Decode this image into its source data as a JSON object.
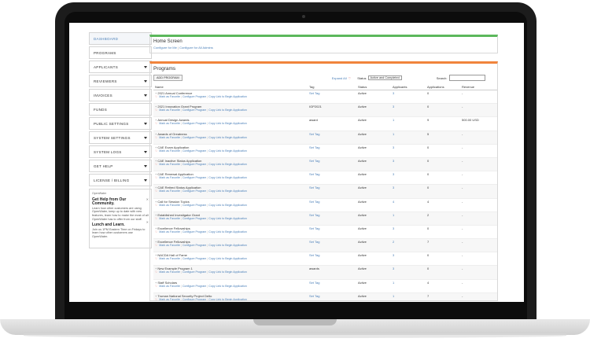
{
  "sidebar": {
    "items": [
      {
        "label": "DASHBOARD",
        "caret": false,
        "active": true
      },
      {
        "label": "PROGRAMS",
        "caret": false
      },
      {
        "label": "APPLICANTS",
        "caret": true
      },
      {
        "label": "REVIEWERS",
        "caret": true
      },
      {
        "label": "INVOICES",
        "caret": true
      },
      {
        "label": "FUNDS",
        "caret": false
      },
      {
        "label": "PUBLIC SETTINGS",
        "caret": true
      },
      {
        "label": "SYSTEM SETTINGS",
        "caret": true
      },
      {
        "label": "SYSTEM LOGS",
        "caret": true
      },
      {
        "label": "GET HELP",
        "caret": true
      },
      {
        "label": "LICENSE / BILLING",
        "caret": true
      }
    ],
    "help": {
      "header": "OpenWater",
      "title1": "Get Help from Our Community.",
      "body1": "Learn how other customers are using OpenWater, keep up to date with new features, learn how to make the most of all OpenWater has to offer from our staff.",
      "title2": "Lunch and Learn.",
      "body2": "Join us 1PM Eastern Time on Fridays to learn how other customers use OpenWater."
    }
  },
  "home": {
    "title": "Home Screen",
    "link_me": "Configure for Me",
    "separator": "|",
    "link_all": "Configure for All Admins"
  },
  "programs": {
    "title": "Programs",
    "add_button": "ADD PROGRAM",
    "expand_all": "Expand All",
    "status_label": "Status",
    "status_value": "Active and Completed",
    "search_label": "Search:",
    "columns": [
      "Name",
      "Tag",
      "Status",
      "Applicants",
      "Applications",
      "Revenue"
    ],
    "link_fav": "Mark as Favorite",
    "link_cfg": "Configure Program",
    "link_copy": "Copy Link to Begin Application",
    "rows": [
      {
        "name": "2021 Annual Conference",
        "tag": "Set Tag",
        "status": "Active",
        "applicants": "3",
        "applications": "0",
        "revenue": "-"
      },
      {
        "name": "2021 Innovation Grant Program",
        "tag": "IGP2021",
        "status": "Active",
        "applicants": "3",
        "applications": "0",
        "revenue": "-"
      },
      {
        "name": "Annual Design Awards",
        "tag": "award",
        "status": "Active",
        "applicants": "1",
        "applications": "9",
        "revenue": "500.00 USD"
      },
      {
        "name": "Awards of Greatness",
        "tag": "Set Tag",
        "status": "Active",
        "applicants": "1",
        "applications": "5",
        "revenue": "-"
      },
      {
        "name": "CAE Exam Application",
        "tag": "Set Tag",
        "status": "Active",
        "applicants": "3",
        "applications": "0",
        "revenue": "-"
      },
      {
        "name": "CAE Inactive Status Application",
        "tag": "Set Tag",
        "status": "Active",
        "applicants": "3",
        "applications": "0",
        "revenue": "-"
      },
      {
        "name": "CAE Renewal Application",
        "tag": "Set Tag",
        "status": "Active",
        "applicants": "3",
        "applications": "0",
        "revenue": "-"
      },
      {
        "name": "CAE Retired Status Application",
        "tag": "Set Tag",
        "status": "Active",
        "applicants": "3",
        "applications": "0",
        "revenue": "-"
      },
      {
        "name": "Call for Session Topics",
        "tag": "Set Tag",
        "status": "Active",
        "applicants": "4",
        "applications": "4",
        "revenue": "-"
      },
      {
        "name": "Established Investigator Grant",
        "tag": "Set Tag",
        "status": "Active",
        "applicants": "1",
        "applications": "2",
        "revenue": "-"
      },
      {
        "name": "Excellence Fellowships",
        "tag": "Set Tag",
        "status": "Active",
        "applicants": "3",
        "applications": "0",
        "revenue": "-"
      },
      {
        "name": "Excellence Fellowships",
        "tag": "Set Tag",
        "status": "Active",
        "applicants": "2",
        "applications": "7",
        "revenue": "-"
      },
      {
        "name": "NACDA Hall of Fame",
        "tag": "Set Tag",
        "status": "Active",
        "applicants": "3",
        "applications": "0",
        "revenue": "-"
      },
      {
        "name": "New Example Program 1",
        "tag": "awards",
        "status": "Active",
        "applicants": "3",
        "applications": "0",
        "revenue": "-"
      },
      {
        "name": "Staff Scholars",
        "tag": "Set Tag",
        "status": "Active",
        "applicants": "1",
        "applications": "4",
        "revenue": "-"
      },
      {
        "name": "Truman National Security Project Delto",
        "tag": "Set Tag",
        "status": "Active",
        "applicants": "1",
        "applications": "7",
        "revenue": "-"
      }
    ]
  }
}
